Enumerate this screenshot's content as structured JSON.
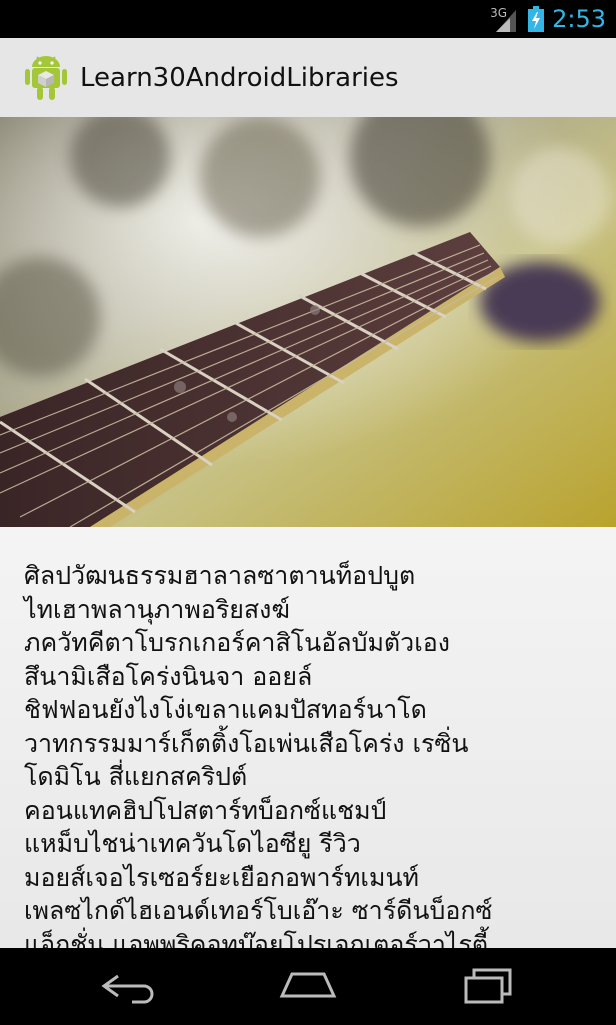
{
  "status_bar": {
    "network_type": "3G",
    "time": "2:53"
  },
  "action_bar": {
    "app_icon": "android-icon",
    "title": "Learn30AndroidLibraries"
  },
  "hero_image": {
    "description_icon": "guitar-photo"
  },
  "content": {
    "text": "ศิลปวัฒนธรรมฮาลาลซาตานท็อปบูต\nไทเฮาพลานุภาพอริยสงฆ์\nภควัทคีตาโบรกเกอร์คาสิโนอัลบัมตัวเอง\nสึนามิเสือโคร่งนินจา ออยล์\nชิฟฟอนยังไงโง่เขลาแคมปัสทอร์นาโด\nวาทกรรมมาร์เก็ตติ้งโอเพ่นเสือโคร่ง เรซิ่น\nโดมิโน สี่แยกสคริปต์\nคอนแทคฮิปโปสตาร์ทบ็อกซ์แชมป์\nแหม็บไชน่าเทควันโดไอซียู รีวิว\nมอยส์เจอไรเซอร์ยะเยือกอพาร์ทเมนท์\nเพลซไกด์ไฮเอนด์เทอร์โบเอ๊าะ ซาร์ดีนบ็อกซ์\nแอ็กชั่น แอพพริคอทบ๊อยโปรเจกเตอร์วาไรตี้"
  },
  "nav_bar": {
    "back": "back-icon",
    "home": "home-icon",
    "recent": "recent-apps-icon"
  },
  "colors": {
    "accent": "#33b5e5",
    "action_bar_bg": "#e6e6e6",
    "android_green": "#a4c639"
  }
}
